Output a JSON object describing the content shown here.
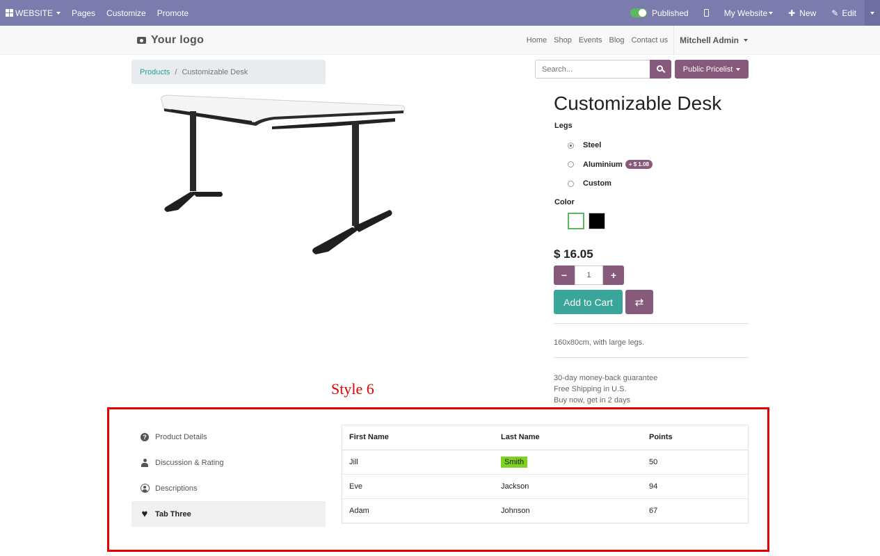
{
  "adminbar": {
    "brand": "WEBSITE",
    "menu": [
      "Pages",
      "Customize",
      "Promote"
    ],
    "published": "Published",
    "site": "My Website",
    "new": "New",
    "edit": "Edit",
    "accent": "#7c7bad"
  },
  "header": {
    "logo": "Your logo",
    "nav": [
      "Home",
      "Shop",
      "Events",
      "Blog",
      "Contact us"
    ],
    "user": "Mitchell Admin"
  },
  "breadcrumb": {
    "root": "Products",
    "current": "Customizable Desk",
    "sep": "/"
  },
  "search": {
    "placeholder": "Search..."
  },
  "pricelist": "Public Pricelist",
  "product": {
    "name": "Customizable Desk",
    "legs_label": "Legs",
    "legs": [
      {
        "label": "Steel",
        "checked": true
      },
      {
        "label": "Aluminium",
        "extra": "+ $ 1.08"
      },
      {
        "label": "Custom"
      }
    ],
    "color_label": "Color",
    "colors": [
      "#ffffff",
      "#000000"
    ],
    "price": "$ 16.05",
    "quantity": "1",
    "add_to_cart": "Add to Cart",
    "description": "160x80cm, with large legs.",
    "terms": [
      "30-day money-back guarantee",
      "Free Shipping in U.S.",
      "Buy now, get in 2 days"
    ]
  },
  "style_label": "Style 6",
  "tabs": [
    {
      "label": "Product Details",
      "icon": "question-circle-icon"
    },
    {
      "label": "Discussion & Rating",
      "icon": "user-icon"
    },
    {
      "label": "Descriptions",
      "icon": "user-circle-icon"
    },
    {
      "label": "Tab Three",
      "icon": "heart-icon",
      "active": true
    }
  ],
  "table": {
    "headers": [
      "First Name",
      "Last Name",
      "Points"
    ],
    "rows": [
      [
        "Jill",
        "Smith",
        "50"
      ],
      [
        "Eve",
        "Jackson",
        "94"
      ],
      [
        "Adam",
        "Johnson",
        "67"
      ]
    ]
  }
}
